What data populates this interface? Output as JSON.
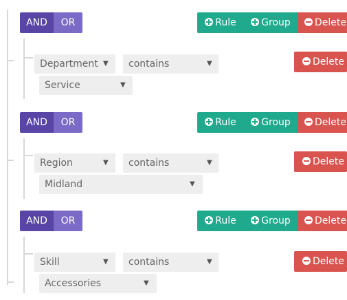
{
  "groups": [
    {
      "condition": {
        "and_label": "AND",
        "or_label": "OR"
      },
      "actions": {
        "rule_label": "Rule",
        "group_label": "Group",
        "delete_label": "Delete"
      },
      "rule": {
        "field": "Department",
        "operator": "contains",
        "value": "Service",
        "delete_label": "Delete"
      }
    },
    {
      "condition": {
        "and_label": "AND",
        "or_label": "OR"
      },
      "actions": {
        "rule_label": "Rule",
        "group_label": "Group",
        "delete_label": "Delete"
      },
      "rule": {
        "field": "Region",
        "operator": "contains",
        "value": "Midland",
        "delete_label": "Delete"
      }
    },
    {
      "condition": {
        "and_label": "AND",
        "or_label": "OR"
      },
      "actions": {
        "rule_label": "Rule",
        "group_label": "Group",
        "delete_label": "Delete"
      },
      "rule": {
        "field": "Skill",
        "operator": "contains",
        "value": "Accessories",
        "delete_label": "Delete"
      }
    }
  ],
  "icons": {
    "add": "plus-circle-icon",
    "remove": "minus-circle-icon",
    "dropdown": "caret-down-icon"
  },
  "colors": {
    "and_active": "#5845a6",
    "or": "#7b6bc6",
    "add": "#1fa98d",
    "delete": "#d9534f",
    "select_bg": "#eeeeee",
    "tree_line": "#d7d7d7"
  }
}
